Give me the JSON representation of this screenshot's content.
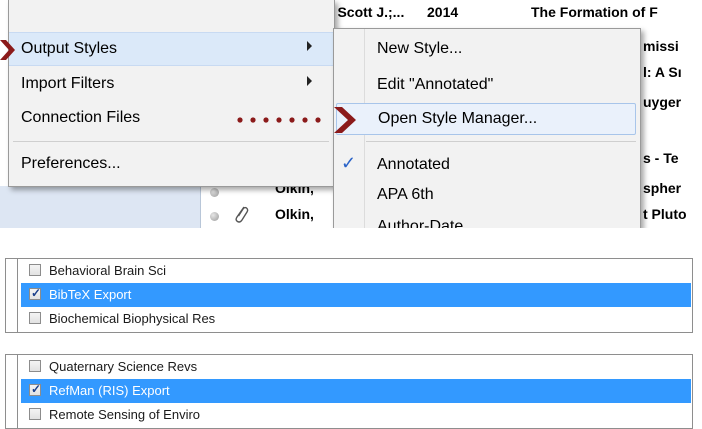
{
  "colors": {
    "pointer_red": "#8b1a1a",
    "menu_bg": "#f2f2f2",
    "selection_blue": "#3399ff",
    "hover_blue": "#dbe9f9",
    "check_blue": "#2a63c8"
  },
  "reference_list": {
    "rows": [
      {
        "author": "), Scott J.;...",
        "year": "2014",
        "title": "The Formation of F"
      },
      {
        "title": "missi"
      },
      {
        "title": "l: A Sı"
      },
      {
        "title": "uyger"
      },
      {
        "title": "s - Te"
      },
      {
        "author": "Olkin,",
        "title": "spher"
      },
      {
        "author": "Olkin,",
        "title": "t Pluto"
      }
    ],
    "icons": [
      "dot-icon",
      "dot-icon",
      "paperclip-icon"
    ]
  },
  "main_menu": {
    "items": [
      {
        "label": "Output Styles",
        "has_submenu": true,
        "active": true
      },
      {
        "label": "Import Filters",
        "has_submenu": true
      },
      {
        "label": "Connection Files",
        "has_submenu": false
      },
      {
        "label": "Preferences...",
        "has_submenu": false
      }
    ]
  },
  "submenu": {
    "items": [
      {
        "label": "New Style..."
      },
      {
        "label": "Edit \"Annotated\""
      },
      {
        "label": "Open Style Manager...",
        "active": true
      },
      {
        "label": "Annotated",
        "checked": true
      },
      {
        "label": "APA 6th"
      },
      {
        "label": "Author-Date"
      }
    ]
  },
  "style_list_1": {
    "rows": [
      {
        "label": "Behavioral Brain Sci",
        "checked": false,
        "selected": false
      },
      {
        "label": "BibTeX Export",
        "checked": true,
        "selected": true
      },
      {
        "label": "Biochemical Biophysical Res",
        "checked": false,
        "selected": false
      }
    ]
  },
  "style_list_2": {
    "rows": [
      {
        "label": "Quaternary Science Revs",
        "checked": false,
        "selected": false
      },
      {
        "label": "RefMan (RIS) Export",
        "checked": true,
        "selected": true
      },
      {
        "label": "Remote Sensing of Enviro",
        "checked": false,
        "selected": false
      }
    ]
  }
}
